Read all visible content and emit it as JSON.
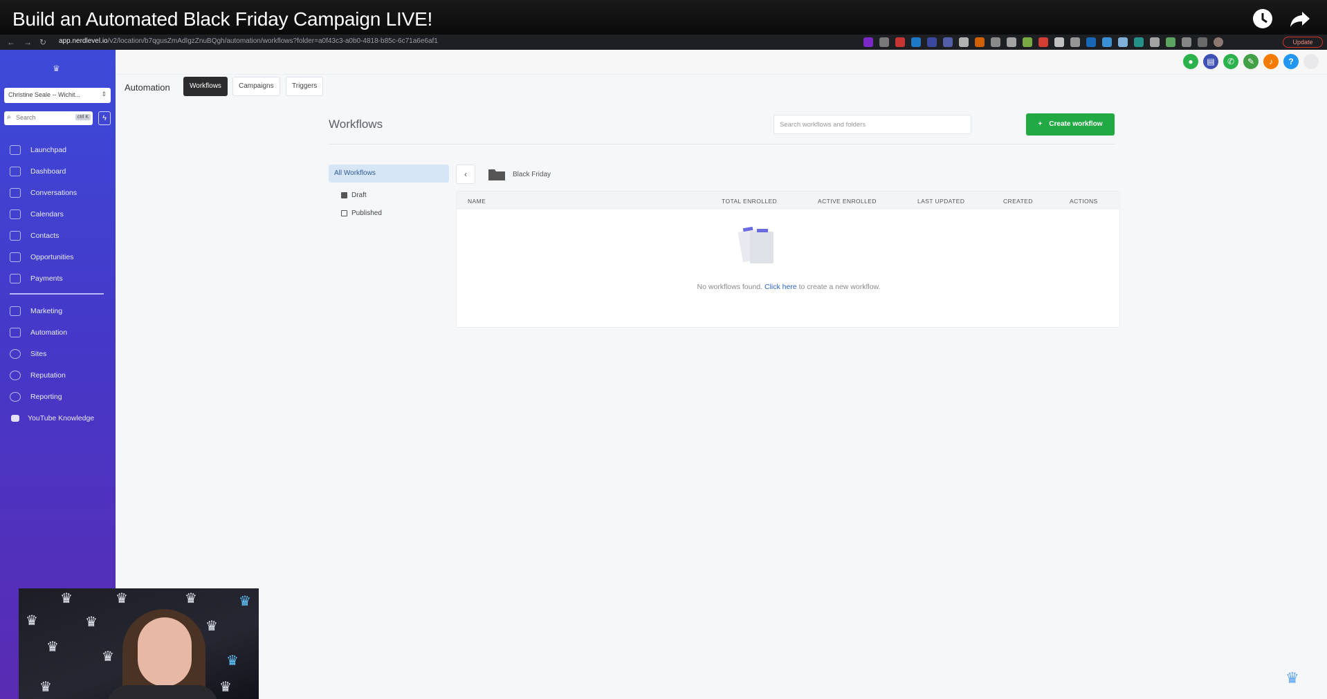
{
  "video": {
    "title": "Build an Automated Black Friday Campaign LIVE!"
  },
  "browser": {
    "url_host": "app.nerdlevel.io",
    "url_path": "/v2/location/b7qgusZmAdIgzZnuBQgh/automation/workflows?folder=a0f43c3-a0b0-4818-b85c-6c71a6e6af1",
    "update_label": "Update"
  },
  "sidebar": {
    "account": "Christine Seale -- Wichit...",
    "search_placeholder": "Search",
    "search_shortcut": "ctrl K",
    "items": [
      {
        "label": "Launchpad",
        "icon": "rocket-icon"
      },
      {
        "label": "Dashboard",
        "icon": "grid-icon"
      },
      {
        "label": "Conversations",
        "icon": "chat-icon"
      },
      {
        "label": "Calendars",
        "icon": "calendar-icon"
      },
      {
        "label": "Contacts",
        "icon": "contact-icon"
      },
      {
        "label": "Opportunities",
        "icon": "opportunity-icon"
      },
      {
        "label": "Payments",
        "icon": "payments-icon"
      },
      {
        "label": "Marketing",
        "icon": "megaphone-icon"
      },
      {
        "label": "Automation",
        "icon": "automation-icon"
      },
      {
        "label": "Sites",
        "icon": "globe-icon"
      },
      {
        "label": "Reputation",
        "icon": "star-icon"
      },
      {
        "label": "Reporting",
        "icon": "chart-icon"
      },
      {
        "label": "YouTube Knowledge",
        "icon": "youtube-icon"
      }
    ]
  },
  "subnav": {
    "title": "Automation",
    "tabs": [
      {
        "label": "Workflows",
        "active": true
      },
      {
        "label": "Campaigns",
        "active": false
      },
      {
        "label": "Triggers",
        "active": false
      }
    ]
  },
  "workflows": {
    "title": "Workflows",
    "search_placeholder": "Search workflows and folders",
    "create_label": "Create workflow",
    "folders": {
      "all": "All Workflows",
      "draft": "Draft",
      "published": "Published"
    },
    "breadcrumb": "Black Friday",
    "columns": [
      "NAME",
      "TOTAL ENROLLED",
      "ACTIVE ENROLLED",
      "LAST UPDATED",
      "CREATED",
      "ACTIONS"
    ],
    "empty_prefix": "No workflows found.",
    "empty_link": "Click here",
    "empty_suffix": "to create a new workflow."
  },
  "colors": {
    "sidebar_top": "#3d4ad8",
    "sidebar_bottom": "#5a2bb3",
    "create_button": "#21a943",
    "active_tab": "#2c2c2e",
    "selected_folder": "#d7e6f7"
  }
}
